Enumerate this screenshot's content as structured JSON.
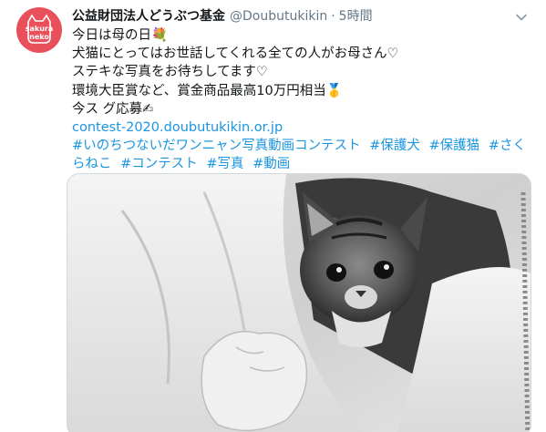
{
  "avatar": {
    "text": "sakura\nneko",
    "color": "#e8505b"
  },
  "author": {
    "display_name": "公益財団法人どうぶつ基金",
    "handle": "@Doubutukikin",
    "separator": "·",
    "time": "5時間"
  },
  "tweet": {
    "lines": [
      "今日は母の日💐",
      "犬猫にとってはお世話してくれる全ての人がお母さん♡",
      "ステキな写真をお待ちしてます♡",
      "環境大臣賞など、賞金商品最高10万円相当🥇",
      "今ス グ応募✍"
    ],
    "link": "contest-2020.doubutukikin.or.jp",
    "hashtags": [
      "#いのちつないだワンニャン写真動画コンテスト",
      "#保護犬",
      "#保護猫",
      "#さくらねこ",
      "#コンテスト",
      "#写真",
      "#動画"
    ]
  },
  "media": {
    "icon": "kitten-photo"
  },
  "colors": {
    "link": "#1b95e0",
    "meta": "#657786",
    "text": "#14171a"
  }
}
